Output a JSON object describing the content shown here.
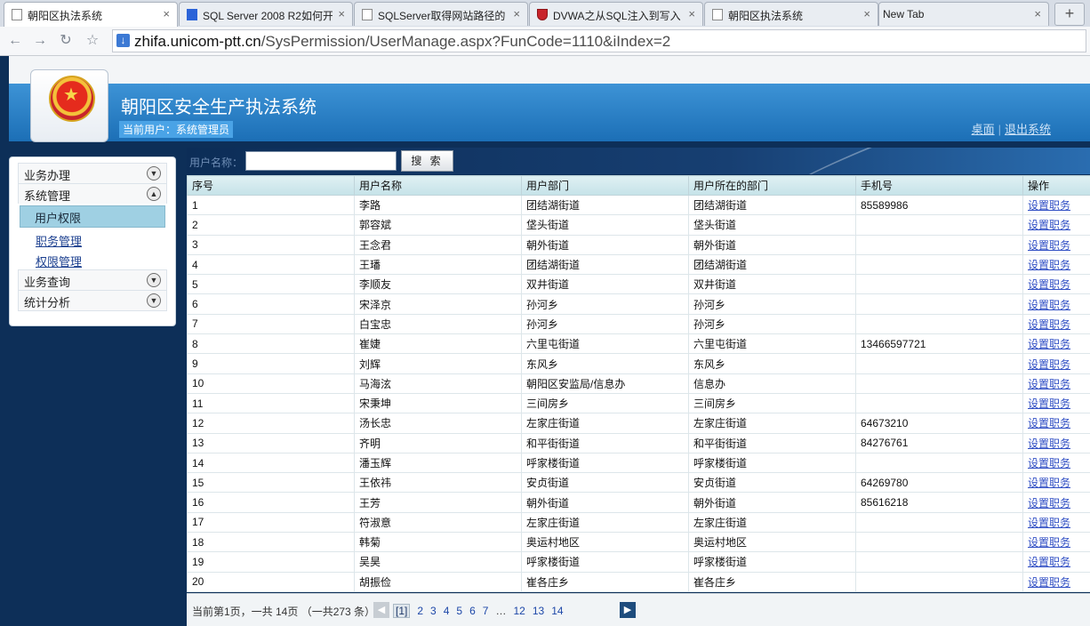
{
  "browser": {
    "tabs": [
      {
        "title": "朝阳区执法系统",
        "active": true,
        "icon": "page-icon"
      },
      {
        "title": "SQL Server 2008 R2如何开",
        "active": false,
        "icon": "baidu-paw-icon"
      },
      {
        "title": "SQLServer取得网站路径的",
        "active": false,
        "icon": "page-icon"
      },
      {
        "title": "DVWA之从SQL注入到写入",
        "active": false,
        "icon": "shield-red-icon"
      },
      {
        "title": "朝阳区执法系统",
        "active": false,
        "icon": "page-icon"
      },
      {
        "title": "New Tab",
        "active": false,
        "icon": "none"
      }
    ],
    "url_host": "zhifa.unicom-ptt.cn",
    "url_path": "/SysPermission/UserManage.aspx?FunCode=1110&iIndex=2"
  },
  "header": {
    "system_title": "朝阳区安全生产执法系统",
    "current_user": "当前用户：系统管理员",
    "link_desktop": "桌面",
    "link_sep": "|",
    "link_logout": "退出系统"
  },
  "sidebar": {
    "menus": [
      {
        "label": "业务办理",
        "expanded": false,
        "items": []
      },
      {
        "label": "系统管理",
        "expanded": true,
        "items": [
          {
            "label": "用户权限",
            "selected": true
          },
          {
            "label": "职务管理",
            "selected": false
          },
          {
            "label": "权限管理",
            "selected": false
          }
        ]
      },
      {
        "label": "业务查询",
        "expanded": false,
        "items": []
      },
      {
        "label": "统计分析",
        "expanded": false,
        "items": []
      }
    ]
  },
  "search": {
    "label": "用户名称：",
    "value": "",
    "button": "搜 索"
  },
  "table": {
    "columns": [
      "序号",
      "用户名称",
      "用户部门",
      "用户所在的部门",
      "手机号",
      "操作"
    ],
    "action_label": "设置职务",
    "rows": [
      [
        "1",
        "李路",
        "团结湖街道",
        "团结湖街道",
        "85589986"
      ],
      [
        "2",
        "郭容斌",
        "垡头街道",
        "垡头街道",
        ""
      ],
      [
        "3",
        "王念君",
        "朝外街道",
        "朝外街道",
        ""
      ],
      [
        "4",
        "王璠",
        "团结湖街道",
        "团结湖街道",
        ""
      ],
      [
        "5",
        "李顺友",
        "双井街道",
        "双井街道",
        ""
      ],
      [
        "6",
        "宋泽京",
        "孙河乡",
        "孙河乡",
        ""
      ],
      [
        "7",
        "白宝忠",
        "孙河乡",
        "孙河乡",
        ""
      ],
      [
        "8",
        "崔婕",
        "六里屯街道",
        "六里屯街道",
        "13466597721"
      ],
      [
        "9",
        "刘辉",
        "东风乡",
        "东风乡",
        ""
      ],
      [
        "10",
        "马海泫",
        "朝阳区安监局/信息办",
        "信息办",
        ""
      ],
      [
        "11",
        "宋秉坤",
        "三间房乡",
        "三间房乡",
        ""
      ],
      [
        "12",
        "汤长忠",
        "左家庄街道",
        "左家庄街道",
        "64673210"
      ],
      [
        "13",
        "齐明",
        "和平街街道",
        "和平街街道",
        "84276761"
      ],
      [
        "14",
        "潘玉辉",
        "呼家楼街道",
        "呼家楼街道",
        ""
      ],
      [
        "15",
        "王依祎",
        "安贞街道",
        "安贞街道",
        "64269780"
      ],
      [
        "16",
        "王芳",
        "朝外街道",
        "朝外街道",
        "85616218"
      ],
      [
        "17",
        "符淑意",
        "左家庄街道",
        "左家庄街道",
        ""
      ],
      [
        "18",
        "韩菊",
        "奥运村地区",
        "奥运村地区",
        ""
      ],
      [
        "19",
        "吴昊",
        "呼家楼街道",
        "呼家楼街道",
        ""
      ],
      [
        "20",
        "胡振俭",
        "崔各庄乡",
        "崔各庄乡",
        ""
      ]
    ]
  },
  "pager": {
    "info": "当前第1页，一共  14页 （一共273 条）",
    "pages": [
      "[1]",
      "2",
      "3",
      "4",
      "5",
      "6",
      "7",
      "…",
      "12",
      "13",
      "14"
    ]
  }
}
